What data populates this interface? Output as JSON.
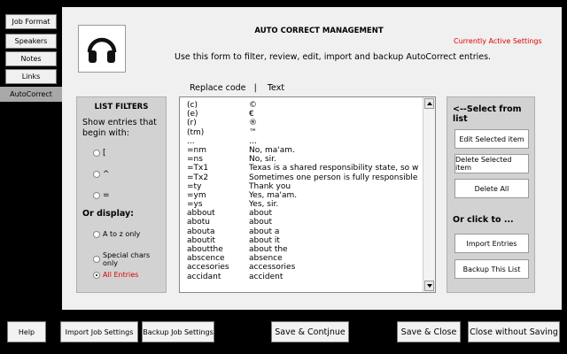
{
  "nav": {
    "tabs": [
      {
        "label": "Job Format",
        "active": false
      },
      {
        "label": "Speakers",
        "active": false
      },
      {
        "label": "Notes",
        "active": false
      },
      {
        "label": "Links",
        "active": false
      },
      {
        "label": "AutoCorrect",
        "active": true
      }
    ]
  },
  "header": {
    "icon": "headphones-icon",
    "title": "AUTO CORRECT MANAGEMENT",
    "active_settings": "Currently Active Settings",
    "description": "Use this form to filter, review, edit, import and backup AutoCorrect entries.",
    "columns": "Replace code   |    Text"
  },
  "filters": {
    "heading": "LIST FILTERS",
    "show_label": "Show entries that begin with:",
    "begin_options": [
      "[",
      "^",
      "="
    ],
    "or_display": "Or display:",
    "display_options": [
      {
        "label": "A to z only",
        "checked": false
      },
      {
        "label": "Special chars only",
        "checked": false
      },
      {
        "label": "All Entries",
        "checked": true
      }
    ]
  },
  "list": {
    "rows": [
      {
        "code": "(c)",
        "text": "©"
      },
      {
        "code": "(e)",
        "text": "€"
      },
      {
        "code": "(r)",
        "text": "®"
      },
      {
        "code": "(tm)",
        "text": "™"
      },
      {
        "code": "...",
        "text": "…"
      },
      {
        "code": "=nm",
        "text": "No, ma'am."
      },
      {
        "code": "=ns",
        "text": "No, sir."
      },
      {
        "code": "=Tx1",
        "text": "Texas is a shared responsibility state, so when o"
      },
      {
        "code": "=Tx2",
        "text": "Sometimes one person is fully responsible for th"
      },
      {
        "code": "=ty",
        "text": "Thank you"
      },
      {
        "code": "=ym",
        "text": "Yes, ma'am."
      },
      {
        "code": "=ys",
        "text": "Yes, sir."
      },
      {
        "code": "abbout",
        "text": "about"
      },
      {
        "code": "abotu",
        "text": "about"
      },
      {
        "code": "abouta",
        "text": "about a"
      },
      {
        "code": "aboutit",
        "text": "about it"
      },
      {
        "code": "aboutthe",
        "text": "about the"
      },
      {
        "code": "abscence",
        "text": "absence"
      },
      {
        "code": "accesories",
        "text": "accessories"
      },
      {
        "code": "accidant",
        "text": "accident"
      }
    ]
  },
  "actions": {
    "select_heading": "<--Select from list",
    "edit": "Edit Selected item",
    "delete_selected": "Delete Selected item",
    "delete_all": "Delete All",
    "click_heading": "Or click to ...",
    "import": "Import Entries",
    "backup": "Backup This List"
  },
  "bottom": {
    "help": "Help",
    "import_job": "Import Job Settings",
    "backup_job": "Backup Job Settings",
    "save_continue": "Save & Contjnue",
    "save_close": "Save & Close",
    "close_nosave": "Close without Saving"
  },
  "colors": {
    "accent_red": "#e00000",
    "panel_gray": "#d2d2d2",
    "background": "#f0f0f0"
  }
}
